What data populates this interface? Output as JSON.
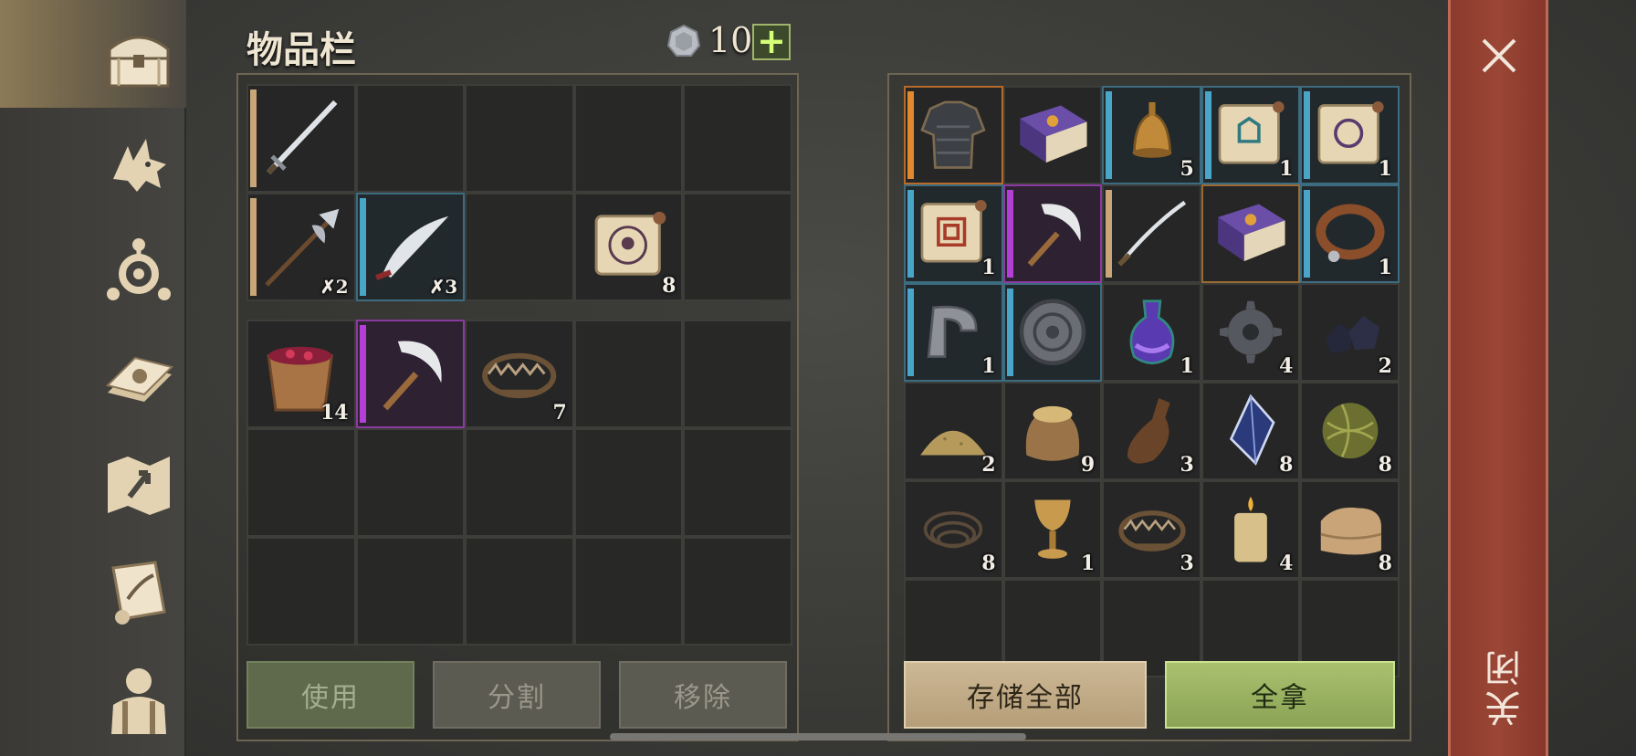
{
  "header": {
    "title": "物品栏",
    "currency_count": "10",
    "add_currency_label": "+"
  },
  "sidebar": {
    "items": [
      {
        "name": "chest-icon",
        "active": true
      },
      {
        "name": "wolf-icon",
        "active": false
      },
      {
        "name": "crafting-icon",
        "active": false
      },
      {
        "name": "recipe-book-icon",
        "active": false
      },
      {
        "name": "map-icon",
        "active": false
      },
      {
        "name": "quest-scroll-icon",
        "active": false
      },
      {
        "name": "character-icon",
        "active": false
      }
    ]
  },
  "inventory": {
    "equipment_rows": [
      [
        {
          "icon": "sword",
          "rarity": "tan",
          "qty": ""
        },
        {
          "icon": "",
          "rarity": "",
          "qty": ""
        },
        {
          "icon": "",
          "rarity": "",
          "qty": ""
        },
        {
          "icon": "",
          "rarity": "",
          "qty": ""
        },
        {
          "icon": "",
          "rarity": "",
          "qty": ""
        }
      ],
      [
        {
          "icon": "halberd",
          "rarity": "tan",
          "qty": "✗2"
        },
        {
          "icon": "scimitar",
          "rarity": "blue",
          "qty": "✗3"
        },
        {
          "icon": "",
          "rarity": "",
          "qty": ""
        },
        {
          "icon": "skull-scroll",
          "rarity": "",
          "qty": "8"
        },
        {
          "icon": "",
          "rarity": "",
          "qty": ""
        }
      ]
    ],
    "bag_rows": [
      [
        {
          "icon": "berry-bucket",
          "rarity": "",
          "qty": "14"
        },
        {
          "icon": "sickle",
          "rarity": "purple",
          "qty": ""
        },
        {
          "icon": "bear-trap",
          "rarity": "",
          "qty": "7"
        },
        {
          "icon": "",
          "rarity": "",
          "qty": ""
        },
        {
          "icon": "",
          "rarity": "",
          "qty": ""
        }
      ],
      [
        {
          "icon": "",
          "rarity": "",
          "qty": ""
        },
        {
          "icon": "",
          "rarity": "",
          "qty": ""
        },
        {
          "icon": "",
          "rarity": "",
          "qty": ""
        },
        {
          "icon": "",
          "rarity": "",
          "qty": ""
        },
        {
          "icon": "",
          "rarity": "",
          "qty": ""
        }
      ],
      [
        {
          "icon": "",
          "rarity": "",
          "qty": ""
        },
        {
          "icon": "",
          "rarity": "",
          "qty": ""
        },
        {
          "icon": "",
          "rarity": "",
          "qty": ""
        },
        {
          "icon": "",
          "rarity": "",
          "qty": ""
        },
        {
          "icon": "",
          "rarity": "",
          "qty": ""
        }
      ]
    ],
    "buttons": {
      "use": "使用",
      "split": "分割",
      "remove": "移除"
    }
  },
  "storage": {
    "rows": [
      [
        {
          "icon": "chainmail",
          "rarity": "orange",
          "qty": ""
        },
        {
          "icon": "purple-book",
          "rarity": "",
          "qty": ""
        },
        {
          "icon": "bell",
          "rarity": "blue",
          "qty": "5"
        },
        {
          "icon": "teal-scroll",
          "rarity": "blue",
          "qty": "1"
        },
        {
          "icon": "purple-scroll",
          "rarity": "blue",
          "qty": "1"
        }
      ],
      [
        {
          "icon": "red-scroll",
          "rarity": "blue",
          "qty": "1"
        },
        {
          "icon": "sickle",
          "rarity": "purple",
          "qty": ""
        },
        {
          "icon": "saber",
          "rarity": "tan",
          "qty": ""
        },
        {
          "icon": "purple-book",
          "rarity": "orange-border",
          "qty": ""
        },
        {
          "icon": "collar",
          "rarity": "blue",
          "qty": "1"
        }
      ],
      [
        {
          "icon": "clamp",
          "rarity": "blue",
          "qty": "1"
        },
        {
          "icon": "shield",
          "rarity": "blue",
          "qty": ""
        },
        {
          "icon": "potion",
          "rarity": "",
          "qty": "1"
        },
        {
          "icon": "gear",
          "rarity": "",
          "qty": "4"
        },
        {
          "icon": "coal",
          "rarity": "",
          "qty": "2"
        }
      ],
      [
        {
          "icon": "sand-pile",
          "rarity": "",
          "qty": "2"
        },
        {
          "icon": "grain-sack",
          "rarity": "",
          "qty": "9"
        },
        {
          "icon": "bottle",
          "rarity": "",
          "qty": "3"
        },
        {
          "icon": "crystal",
          "rarity": "",
          "qty": "8"
        },
        {
          "icon": "fiber-ball",
          "rarity": "",
          "qty": "8"
        }
      ],
      [
        {
          "icon": "rope",
          "rarity": "",
          "qty": "8"
        },
        {
          "icon": "goblet",
          "rarity": "",
          "qty": "1"
        },
        {
          "icon": "bear-trap",
          "rarity": "",
          "qty": "3"
        },
        {
          "icon": "candle",
          "rarity": "",
          "qty": "4"
        },
        {
          "icon": "leather",
          "rarity": "",
          "qty": "8"
        }
      ],
      [
        {
          "icon": "",
          "rarity": "",
          "qty": ""
        },
        {
          "icon": "",
          "rarity": "",
          "qty": ""
        },
        {
          "icon": "",
          "rarity": "",
          "qty": ""
        },
        {
          "icon": "",
          "rarity": "",
          "qty": ""
        },
        {
          "icon": "",
          "rarity": "",
          "qty": ""
        }
      ]
    ],
    "buttons": {
      "store_all": "存储全部",
      "take_all": "全拿"
    }
  },
  "close": {
    "label": "关闭"
  }
}
